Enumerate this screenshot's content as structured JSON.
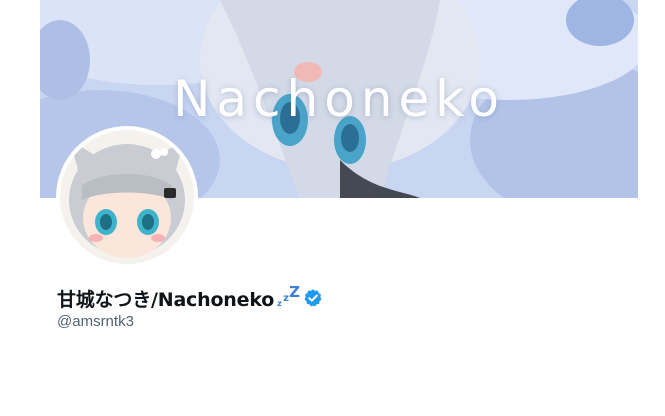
{
  "banner": {
    "title": "Nachoneko",
    "colors": {
      "base": "#c9d6f2",
      "light": "#e6edfb",
      "shade": "#a9bbe3",
      "hair": "#d8dde8",
      "eye": "#4aa3c8"
    }
  },
  "profile": {
    "display_name": "甘城なつき/Nachoneko",
    "sleep_emoji": [
      "z",
      "z",
      "Z"
    ],
    "handle": "@amsrntk3",
    "verified": true,
    "verified_color": "#1d9bf0",
    "avatar_icon": "avatar-anime-girl"
  }
}
